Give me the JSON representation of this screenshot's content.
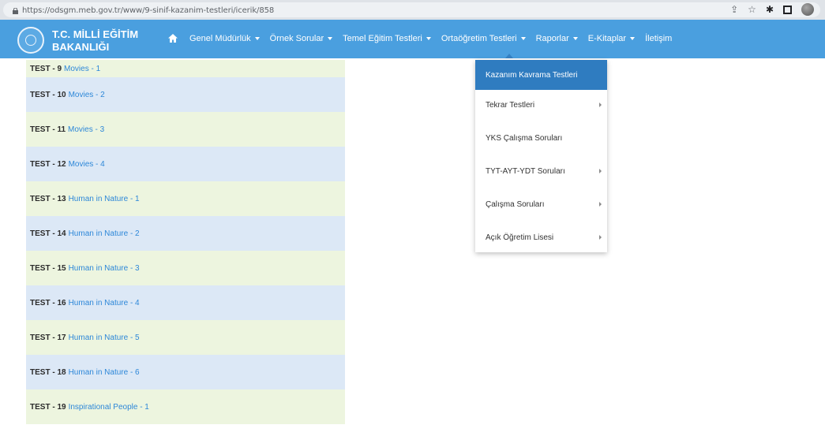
{
  "browser": {
    "url": "https://odsgm.meb.gov.tr/www/9-sinif-kazanim-testleri/icerik/858",
    "icons": [
      "share-icon",
      "bookmark-star-icon",
      "extensions-icon",
      "sidebar-icon",
      "profile-avatar"
    ]
  },
  "navbar": {
    "brand_line1": "T.C. MİLLİ EĞİTİM",
    "brand_line2": "BAKANLIĞI",
    "items": [
      {
        "label": "Genel Müdürlük",
        "has_caret": true
      },
      {
        "label": "Örnek Sorular",
        "has_caret": true
      },
      {
        "label": "Temel Eğitim Testleri",
        "has_caret": true
      },
      {
        "label": "Ortaöğretim Testleri",
        "has_caret": true
      },
      {
        "label": "Raporlar",
        "has_caret": true
      },
      {
        "label": "E-Kitaplar",
        "has_caret": true
      },
      {
        "label": "İletişim",
        "has_caret": false
      }
    ],
    "colors": {
      "bar": "#4a9fdf",
      "active": "#2f7cc0"
    }
  },
  "tests": [
    {
      "num": "TEST - 9",
      "topic": "Movies - 1"
    },
    {
      "num": "TEST - 10",
      "topic": "Movies - 2"
    },
    {
      "num": "TEST - 11",
      "topic": "Movies - 3"
    },
    {
      "num": "TEST - 12",
      "topic": "Movies - 4"
    },
    {
      "num": "TEST - 13",
      "topic": "Human in Nature - 1"
    },
    {
      "num": "TEST - 14",
      "topic": "Human in Nature - 2"
    },
    {
      "num": "TEST - 15",
      "topic": "Human in Nature - 3"
    },
    {
      "num": "TEST - 16",
      "topic": "Human in Nature - 4"
    },
    {
      "num": "TEST - 17",
      "topic": "Human in Nature - 5"
    },
    {
      "num": "TEST - 18",
      "topic": "Human in Nature - 6"
    },
    {
      "num": "TEST - 19",
      "topic": "Inspirational People - 1"
    }
  ],
  "dropdown": {
    "items": [
      {
        "label": "Kazanım Kavrama Testleri",
        "active": true,
        "submenu": false
      },
      {
        "label": "Tekrar Testleri",
        "active": false,
        "submenu": true
      },
      {
        "label": "YKS Çalışma Soruları",
        "active": false,
        "submenu": false
      },
      {
        "label": "TYT-AYT-YDT Soruları",
        "active": false,
        "submenu": true
      },
      {
        "label": "Çalışma Soruları",
        "active": false,
        "submenu": true
      },
      {
        "label": "Açık Öğretim Lisesi",
        "active": false,
        "submenu": true
      }
    ]
  }
}
